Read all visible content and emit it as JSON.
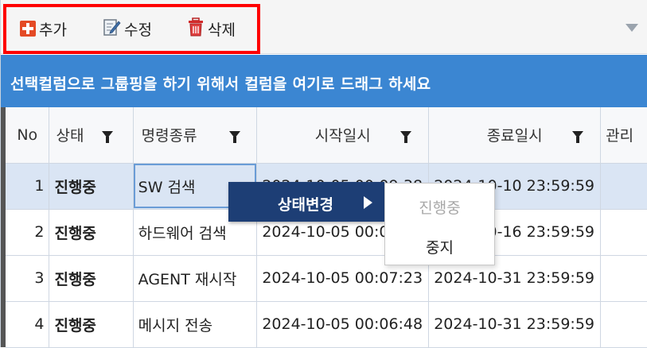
{
  "toolbar": {
    "add_label": "추가",
    "edit_label": "수정",
    "delete_label": "삭제",
    "icons": {
      "add": "plus-icon",
      "edit": "edit-icon",
      "delete": "trash-icon"
    },
    "highlight_color": "#ff0000"
  },
  "group_panel": {
    "text": "선택컬럼으로 그룹핑을 하기 위해서 컬럼을 여기로 드래그 하세요",
    "color": "#3b86d2"
  },
  "grid": {
    "columns": [
      "No",
      "상태",
      "명령종류",
      "시작일시",
      "종료일시",
      "관리"
    ],
    "rows": [
      {
        "no": "1",
        "status": "진행중",
        "type": "SW 검색",
        "start": "2024-10-05 00:09:38",
        "end": "2024-10-10 23:59:59",
        "manage": ""
      },
      {
        "no": "2",
        "status": "진행중",
        "type": "하드웨어 검색",
        "start": "2024-10-05 00:08:11",
        "end": "2024-10-16 23:59:59",
        "manage": ""
      },
      {
        "no": "3",
        "status": "진행중",
        "type": "AGENT 재시작",
        "start": "2024-10-05 00:07:23",
        "end": "2024-10-31 23:59:59",
        "manage": ""
      },
      {
        "no": "4",
        "status": "진행중",
        "type": "메시지 전송",
        "start": "2024-10-05 00:06:48",
        "end": "2024-10-31 23:59:59",
        "manage": ""
      }
    ],
    "selected_color": "#dae5f4"
  },
  "context_menu": {
    "label": "상태변경",
    "color": "#1d3e75",
    "submenu": [
      "진행중",
      "중지"
    ]
  }
}
